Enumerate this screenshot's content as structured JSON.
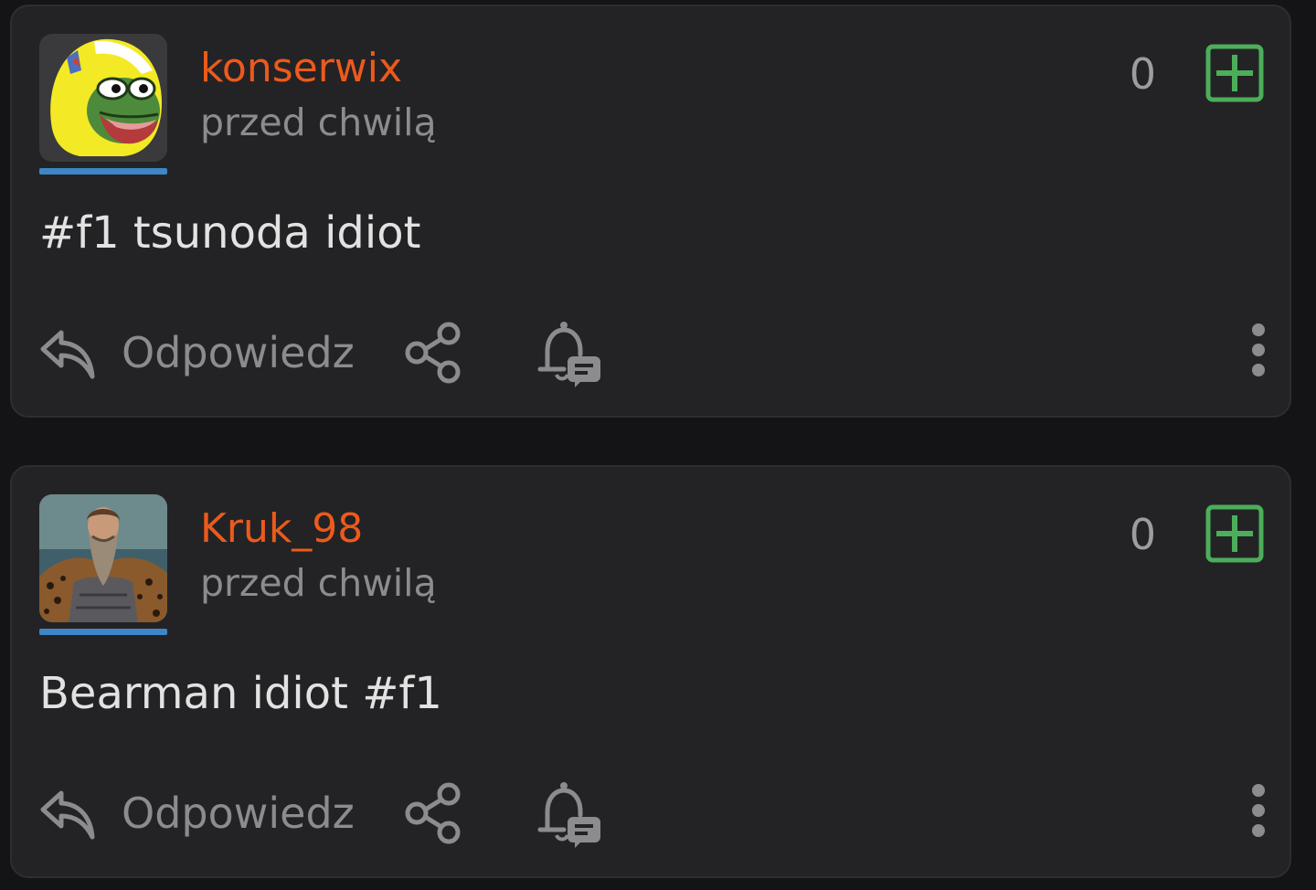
{
  "theme": {
    "background": "#141416",
    "card": "#232325",
    "username_color": "#ec5a1c",
    "meta_color": "#8c8c8e",
    "plus_color": "#4cae5a",
    "avatar_bar": "#3f86c6"
  },
  "posts": [
    {
      "author": "konserwix",
      "time": "przed chwilą",
      "votes": "0",
      "content": "#f1 tsunoda idiot",
      "reply_label": "Odpowiedz",
      "avatar_icon": "pepe-helmet-avatar"
    },
    {
      "author": "Kruk_98",
      "time": "przed chwilą",
      "votes": "0",
      "content": "Bearman idiot #f1",
      "reply_label": "Odpowiedz",
      "avatar_icon": "portrait-avatar"
    }
  ],
  "icons": {
    "reply": "reply-icon",
    "share": "share-icon",
    "observe": "bell-comment-icon",
    "more": "more-vertical-icon",
    "plus": "plus-square-icon"
  }
}
